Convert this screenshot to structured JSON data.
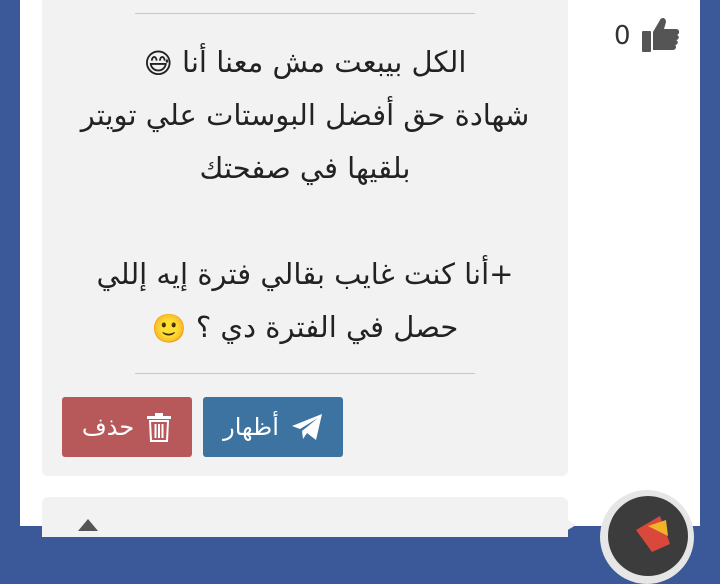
{
  "post": {
    "lines": [
      "الكل بيبعت مش معنا أنا",
      "شهادة حق أفضل البوستات علي تويتر",
      "بلقيها في صفحتك",
      "",
      "+أنا كنت غايب بقالي فترة إيه إللي",
      "حصل في الفترة دي ؟"
    ],
    "emoji_line1": "😅",
    "emoji_line6": "🙂"
  },
  "buttons": {
    "publish_label": "أظهار",
    "delete_label": "حذف"
  },
  "like": {
    "count": "0",
    "icon": "thumbs-up-icon"
  },
  "colors": {
    "page_background": "#3b5998",
    "card_background": "#f2f2f2",
    "publish_button": "#3d73a0",
    "delete_button": "#b7595b"
  }
}
